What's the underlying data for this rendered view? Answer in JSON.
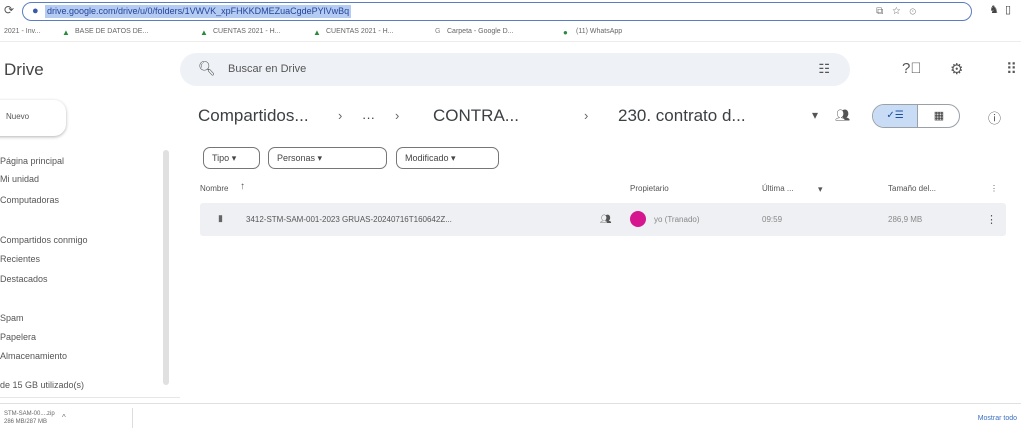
{
  "browser": {
    "url": "drive.google.com/drive/u/0/folders/1VWVK_xpFHKKDMEZuaCgdePYlVwBq",
    "bookmarks": [
      "2021 - Inv...",
      "BASE DE DATOS DE...",
      "CUENTAS 2021 - H...",
      "CUENTAS 2021 - H...",
      "Carpeta - Google D...",
      "(11) WhatsApp"
    ]
  },
  "header": {
    "app_title": "Drive",
    "search_placeholder": "Buscar en Drive"
  },
  "sidebar": {
    "new_button": "Nuevo",
    "items": [
      {
        "label": "Página principal"
      },
      {
        "label": "Mi unidad"
      },
      {
        "label": "Computadoras"
      },
      {
        "label": "Compartidos conmigo"
      },
      {
        "label": "Recientes"
      },
      {
        "label": "Destacados"
      },
      {
        "label": "Spam"
      },
      {
        "label": "Papelera"
      },
      {
        "label": "Almacenamiento"
      }
    ],
    "storage_text": "de 15 GB utilizado(s)"
  },
  "breadcrumb": {
    "items": [
      "Compartidos...",
      "···",
      "CONTRA...",
      "230. contrato d..."
    ]
  },
  "filters": [
    "Tipo",
    "Personas",
    "Modificado"
  ],
  "table": {
    "headers": {
      "name": "Nombre",
      "owner": "Propietario",
      "modified": "Última ...",
      "size": "Tamaño del..."
    },
    "rows": [
      {
        "name": "3412-STM-SAM-001-2023 GRUAS-20240716T160642Z...",
        "owner": "yo (Tranado)",
        "modified": "09:59",
        "size": "286,9 MB"
      }
    ]
  },
  "downloads": {
    "file_name": "STM-SAM-00....zip",
    "file_size": "286 MB/287 MB",
    "show_all": "Mostrar todo"
  },
  "colors": {
    "accent": "#1a73e8",
    "avatar": "#d6168f",
    "selected_toggle": "#c9dcf6"
  }
}
